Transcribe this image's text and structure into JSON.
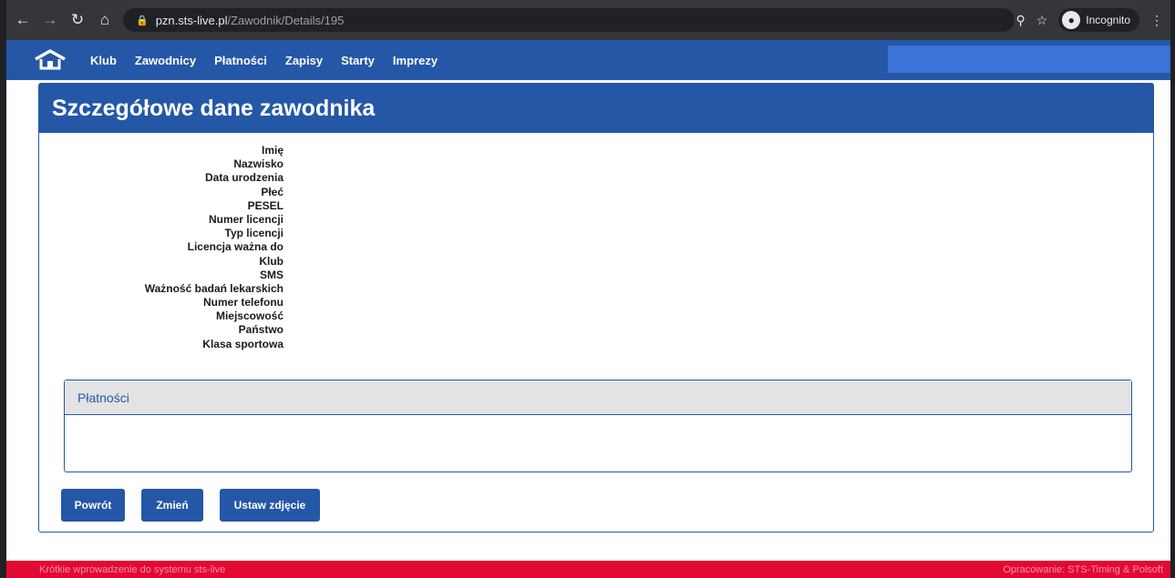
{
  "browser": {
    "url_host": "pzn.sts-live.pl",
    "url_path": "/Zawodnik/Details/195",
    "incognito_label": "Incognito"
  },
  "nav": {
    "items": [
      {
        "label": "Klub"
      },
      {
        "label": "Zawodnicy"
      },
      {
        "label": "Płatności"
      },
      {
        "label": "Zapisy"
      },
      {
        "label": "Starty"
      },
      {
        "label": "Imprezy"
      }
    ]
  },
  "page": {
    "title": "Szczegółowe dane zawodnika"
  },
  "details": {
    "fields": [
      {
        "label": "Imię"
      },
      {
        "label": "Nazwisko"
      },
      {
        "label": "Data urodzenia"
      },
      {
        "label": "Płeć"
      },
      {
        "label": "PESEL"
      },
      {
        "label": "Numer licencji"
      },
      {
        "label": "Typ licencji"
      },
      {
        "label": "Licencja ważna do"
      },
      {
        "label": "Klub"
      },
      {
        "label": "SMS"
      },
      {
        "label": "Ważność badań lekarskich"
      },
      {
        "label": "Numer telefonu"
      },
      {
        "label": "Miejscowość"
      },
      {
        "label": "Państwo"
      },
      {
        "label": "Klasa sportowa"
      }
    ]
  },
  "payments": {
    "title": "Płatności"
  },
  "buttons": {
    "back": "Powrót",
    "edit": "Zmień",
    "set_photo": "Ustaw zdjęcie"
  },
  "footer": {
    "left": "Krótkie wprowadzenie do systemu sts-live",
    "right": "Opracowanie: STS-Timing & Polsoft"
  },
  "colors": {
    "primary": "#2557a7",
    "footer": "#e20a32",
    "panel_header": "#e3e3e3"
  }
}
